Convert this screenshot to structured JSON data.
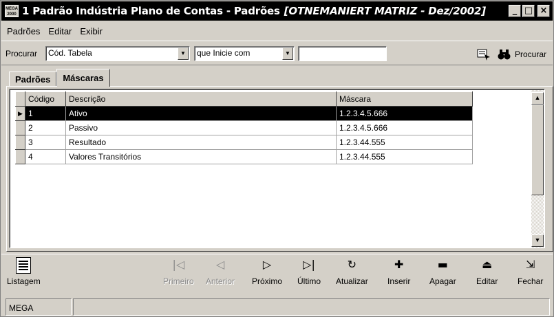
{
  "window": {
    "icon_text_top": "MEGA",
    "icon_text_bottom": "2000",
    "title": "1 Padrão Indústria Plano de Contas - Padrões",
    "title_context": "[OTNEMANIERT MATRIZ - Dez/2002]",
    "minimize": "_",
    "maximize": "□",
    "close": "×"
  },
  "menu": [
    "Padrões",
    "Editar",
    "Exibir"
  ],
  "search": {
    "label": "Procurar",
    "field_value": "Cód. Tabela",
    "condition_value": "que Inicie com",
    "text_value": "",
    "button_label": "Procurar"
  },
  "tabs": [
    {
      "label": "Padrões",
      "active": false
    },
    {
      "label": "Máscaras",
      "active": true
    }
  ],
  "grid": {
    "columns": [
      "Código",
      "Descrição",
      "Máscara"
    ],
    "rows": [
      {
        "codigo": "1",
        "descricao": "Ativo",
        "mascara": "1.2.3.4.5.666",
        "selected": true
      },
      {
        "codigo": "2",
        "descricao": "Passivo",
        "mascara": "1.2.3.4.5.666",
        "selected": false
      },
      {
        "codigo": "3",
        "descricao": "Resultado",
        "mascara": "1.2.3.44.555",
        "selected": false
      },
      {
        "codigo": "4",
        "descricao": "Valores Transitórios",
        "mascara": "1.2.3.44.555",
        "selected": false
      }
    ]
  },
  "toolbar": {
    "listagem": "Listagem",
    "primeiro": "Primeiro",
    "anterior": "Anterior",
    "proximo": "Próximo",
    "ultimo": "Último",
    "atualizar": "Atualizar",
    "inserir": "Inserir",
    "apagar": "Apagar",
    "editar": "Editar",
    "fechar": "Fechar"
  },
  "status": {
    "left": "MEGA",
    "right": ""
  }
}
